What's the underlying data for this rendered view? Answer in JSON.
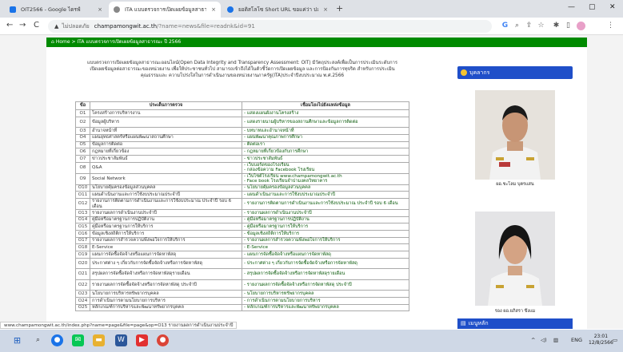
{
  "browser": {
    "tabs": [
      {
        "title": "OIT2566 - Google ไดรฟ์",
        "favicon_color": "#1a73e8",
        "active": false
      },
      {
        "title": "ITA แบบตรวจการเปิดเผยข้อมูลสาธารณะ",
        "favicon_color": "#777777",
        "active": true
      },
      {
        "title": "ยอดิสโลโซ Short URL ขอแค่ว่า ปลอดภ...",
        "favicon_color": "#1a73e8",
        "active": false
      }
    ],
    "new_tab": "+",
    "url": {
      "security": "ไม่ปลอดภัย",
      "host": "champamongwit.ac.th",
      "path": "/?name=news&file=readnk&id=91"
    }
  },
  "page": {
    "breadcrumb": {
      "home": "Home",
      "sep": " > ",
      "current": "ITA แบบตรวจการเปิดเผยข้อมูลสาธารณะ ปี 2566"
    },
    "intro": "แบบตรวจการเปิดเผยข้อมูลสาธารณะออนไลน์(Open Data Integrity and Transparency Assessment: OIT) มีวัตถุประสงค์เพื่อเป็นการประเมินระดับการเปิดเผยข้อมูลต่อสาธารณะของหน่วยงาน เพื่อให้ประชาชนทั่วไป สามารถเข้าถึงได้ในตัวชี้วัดการเปิดเผยข้อมูล และการป้องกันการทุจริต สำหรับการประเมินคุณธรรมและ ความโปร่งใสในการดำเนินงานของหน่วยงานภาครัฐ(ITA)ประจำปีงบประมาณ พ.ศ.2566",
    "table": {
      "headers": [
        "ข้อ",
        "ประเด็นการตรวจ",
        "เชื่อมโยงไปยังแหล่งข้อมูล"
      ],
      "rows": [
        {
          "no": "O1",
          "topic": "โครงสร้างการบริหารงาน",
          "link": "- แสดงแผนผังงานโครงสร้าง"
        },
        {
          "no": "O2",
          "topic": "ข้อมูลผู้บริหาร",
          "link": "- แสดงรายนามผู้บริหารของสถานศึกษาและข้อมูลการติดต่อ"
        },
        {
          "no": "O3",
          "topic": "อำนาจหน้าที่",
          "link": "- บทบาทและอำนาจหน้าที่"
        },
        {
          "no": "O4",
          "topic": "แผนยุทธศาสตร์หรือแผนพัฒนาสถานศึกษา",
          "link": "- แผนพัฒนาคุณภาพการศึกษา"
        },
        {
          "no": "O5",
          "topic": "ข้อมูลการติดต่อ",
          "link": "- ติดต่อเรา"
        },
        {
          "no": "O6",
          "topic": "กฎหมายที่เกี่ยวข้อง",
          "link": "- กฎหมายที่เกี่ยวข้องกับการศึกษา"
        },
        {
          "no": "O7",
          "topic": "ข่าวประชาสัมพันธ์",
          "link": "- ข่าวประชาสัมพันธ์"
        },
        {
          "no": "O8",
          "topic": "Q&A",
          "link": "- เว็บบอร์ดของโรงเรียน\n- กล่องข้อความ Facebook โรงเรียน"
        },
        {
          "no": "O9",
          "topic": "Social Network",
          "link": "- เว็บไซต์โรงเรียน www.champamongwit.ac.th\n- Face book โรงเรียนจำปามงคลวิทยาคาร"
        },
        {
          "no": "O10",
          "topic": "นโยบายคุ้มครองข้อมูลส่วนบุคคล",
          "link": "- นโยบายคุ้มครองข้อมูลส่วนบุคคล"
        },
        {
          "no": "O11",
          "topic": "แผนดำเนินงานและการใช้งบประมาณประจำปี",
          "link": "- แผนดำเนินงานและการใช้งบประมาณประจำปี"
        },
        {
          "no": "O12",
          "topic": "รายงานการติดตามการดำเนินงานและการใช้งบประมาณ ประจำปี รอบ 6 เดือน",
          "link": "- รายงานการติดตามการดำเนินงานและการใช้งบประมาณ ประจำปี รอบ 6 เดือน"
        },
        {
          "no": "O13",
          "topic": "รายงานผลการดำเนินงานประจำปี",
          "link": "- รายงานผลการดำเนินงานประจำปี"
        },
        {
          "no": "O14",
          "topic": "คู่มือหรือมาตรฐานการปฏิบัติงาน",
          "link": "- คู่มือหรือมาตรฐานการปฏิบัติงาน"
        },
        {
          "no": "O15",
          "topic": "คู่มือหรือมาตรฐานการให้บริการ",
          "link": "- คู่มือหรือมาตรฐานการให้บริการ"
        },
        {
          "no": "O16",
          "topic": "ข้อมูลเชิงสถิติการให้บริการ",
          "link": "- ข้อมูลเชิงสถิติการให้บริการ"
        },
        {
          "no": "O17",
          "topic": "รายงานผลการสำรวจความพึงพอใจการให้บริการ",
          "link": "- รายงานผลการสำรวจความพึงพอใจการให้บริการ"
        },
        {
          "no": "O18",
          "topic": "E-Service",
          "link": "- E-Service"
        },
        {
          "no": "O19",
          "topic": "แผนการจัดซื้อจัดจ้างหรือแผนการจัดหาพัสดุ",
          "link": "- แผนการจัดซื้อจัดจ้างหรือแผนการจัดหาพัสดุ"
        },
        {
          "no": "O20",
          "topic": "ประกาศต่าง ๆ เกี่ยวกับการจัดซื้อจัดจ้างหรือการจัดหาพัสดุ",
          "link": "- ประกาศต่าง ๆ เกี่ยวกับการจัดซื้อจัดจ้างหรือการจัดหาพัสดุ"
        },
        {
          "no": "O21",
          "topic": "สรุปผลการจัดซื้อจัดจ้างหรือการจัดหาพัสดุรายเดือน",
          "link": "- สรุปผลการจัดซื้อจัดจ้างหรือการจัดหาพัสดุรายเดือน"
        },
        {
          "no": "O22",
          "topic": "รายงานผลการจัดซื้อจัดจ้างหรือการจัดหาพัสดุ ประจำปี",
          "link": "- รายงานผลการจัดซื้อจัดจ้างหรือการจัดหาพัสดุ ประจำปี"
        },
        {
          "no": "O23",
          "topic": "นโยบายการบริหารทรัพยากรบุคคล",
          "link": "- นโยบายการบริหารทรัพยากรบุคคล"
        },
        {
          "no": "O24",
          "topic": "การดำเนินการตามนโยบายการบริหาร",
          "link": "- การดำเนินการตามนโยบายการบริหาร"
        },
        {
          "no": "O25",
          "topic": "หลักเกณฑ์การบริหารและพัฒนาทรัพยากรบุคคล",
          "link": "- หลักเกณฑ์การบริหารและพัฒนาทรัพยากรบุคคล"
        }
      ]
    },
    "sidebar": {
      "personnel_title": "บุคลากร",
      "person1": "ผอ.ชะโลม บุตรแสน",
      "person2": "รอง ผอ.ยภิสรา ขึงแม",
      "menu_title": "เมนูหลัก"
    }
  },
  "status_link": "www.champamongwit.ac.th/index.php?name=page&file=page&op=O13 รายงานผลการดำเนินงานประจำปี",
  "taskbar": {
    "lang": "ENG",
    "time": "23:01",
    "date": "12/8/2566"
  }
}
